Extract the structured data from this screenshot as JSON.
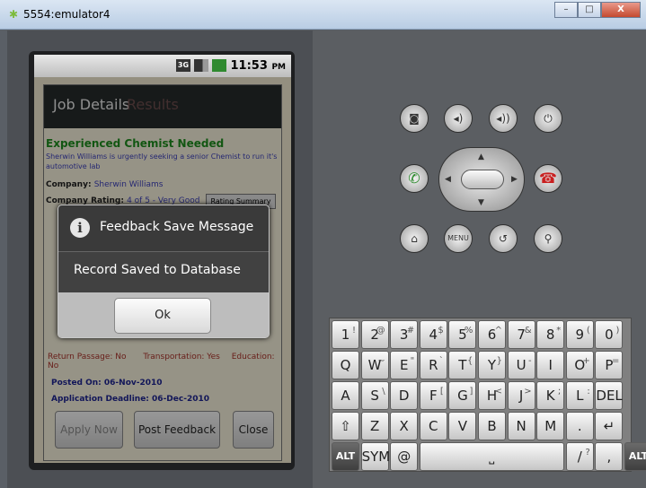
{
  "window": {
    "title": "5554:emulator4",
    "minimize_label": "–",
    "maximize_label": "□",
    "close_label": "X"
  },
  "statusbar": {
    "time": "11:53",
    "ampm": "PM",
    "network": "3G"
  },
  "job": {
    "header_title": "Job Details",
    "header_faded": "Results",
    "title": "Experienced Chemist Needed",
    "description": "Sherwin Williams is urgently seeking a senior Chemist to run it's automotive lab",
    "company_label": "Company:",
    "company": "Sherwin Williams",
    "rating_label": "Company Rating:",
    "rating": "4 of 5 - Very Good",
    "rating_button": "Rating Summary",
    "return_passage": "Return Passage: No",
    "transportation": "Transportation: Yes",
    "education": "Education: No",
    "posted_on": "Posted On: 06-Nov-2010",
    "deadline": "Application Deadline: 06-Dec-2010",
    "apply_label": "Apply Now",
    "feedback_label": "Post Feedback",
    "close_label": "Close"
  },
  "dialog": {
    "title": "Feedback Save Message",
    "message": "Record Saved to Database",
    "ok_label": "Ok"
  },
  "controls": {
    "menu_label": "MENU"
  },
  "keyboard": {
    "row1": [
      "1",
      "2",
      "3",
      "4",
      "5",
      "6",
      "7",
      "8",
      "9",
      "0"
    ],
    "row1_alt": [
      "!",
      "@",
      "#",
      "$",
      "%",
      "^",
      "&",
      "*",
      "(",
      ")"
    ],
    "row2": [
      "Q",
      "W",
      "E",
      "R",
      "T",
      "Y",
      "U",
      "I",
      "O",
      "P"
    ],
    "row2_alt": [
      "",
      "~",
      "\"",
      "`",
      "{",
      "}",
      "-",
      "",
      "+",
      "="
    ],
    "row3": [
      "A",
      "S",
      "D",
      "F",
      "G",
      "H",
      "J",
      "K",
      "L"
    ],
    "row3_alt": [
      "",
      "\\",
      "",
      "[",
      "]",
      "<",
      ">",
      ";",
      ":"
    ],
    "del_label": "DEL",
    "row4": [
      "Z",
      "X",
      "C",
      "V",
      "B",
      "N",
      "M",
      "."
    ],
    "alt_label": "ALT",
    "sym_label": "SYM",
    "at_label": "@",
    "slash_label": "/",
    "slash_alt": "?",
    "comma_label": ","
  }
}
